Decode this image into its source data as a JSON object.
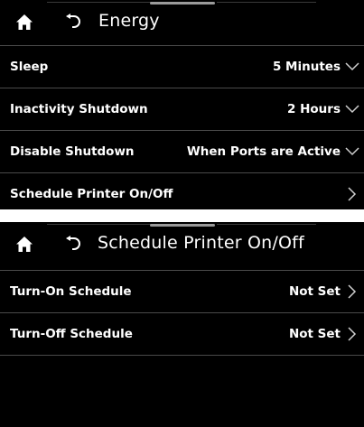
{
  "energy_screen": {
    "title": "Energy",
    "rows": [
      {
        "label": "Sleep",
        "value": "5 Minutes",
        "control": "chevron-down"
      },
      {
        "label": "Inactivity Shutdown",
        "value": "2 Hours",
        "control": "chevron-down"
      },
      {
        "label": "Disable Shutdown",
        "value": "When Ports are Active",
        "control": "chevron-down"
      },
      {
        "label": "Schedule Printer On/Off",
        "value": "",
        "control": "chevron-right"
      }
    ]
  },
  "schedule_screen": {
    "title": "Schedule Printer On/Off",
    "rows": [
      {
        "label": "Turn-On Schedule",
        "value": "Not Set",
        "control": "chevron-right"
      },
      {
        "label": "Turn-Off Schedule",
        "value": "Not Set",
        "control": "chevron-right"
      }
    ]
  },
  "icons": {
    "home": "home-icon",
    "back": "back-arrow-icon",
    "dropdown": "chevron-down-icon",
    "navigate": "chevron-right-icon"
  },
  "colors": {
    "background": "#000000",
    "text": "#ffffff",
    "divider": "#4a4a4a"
  }
}
